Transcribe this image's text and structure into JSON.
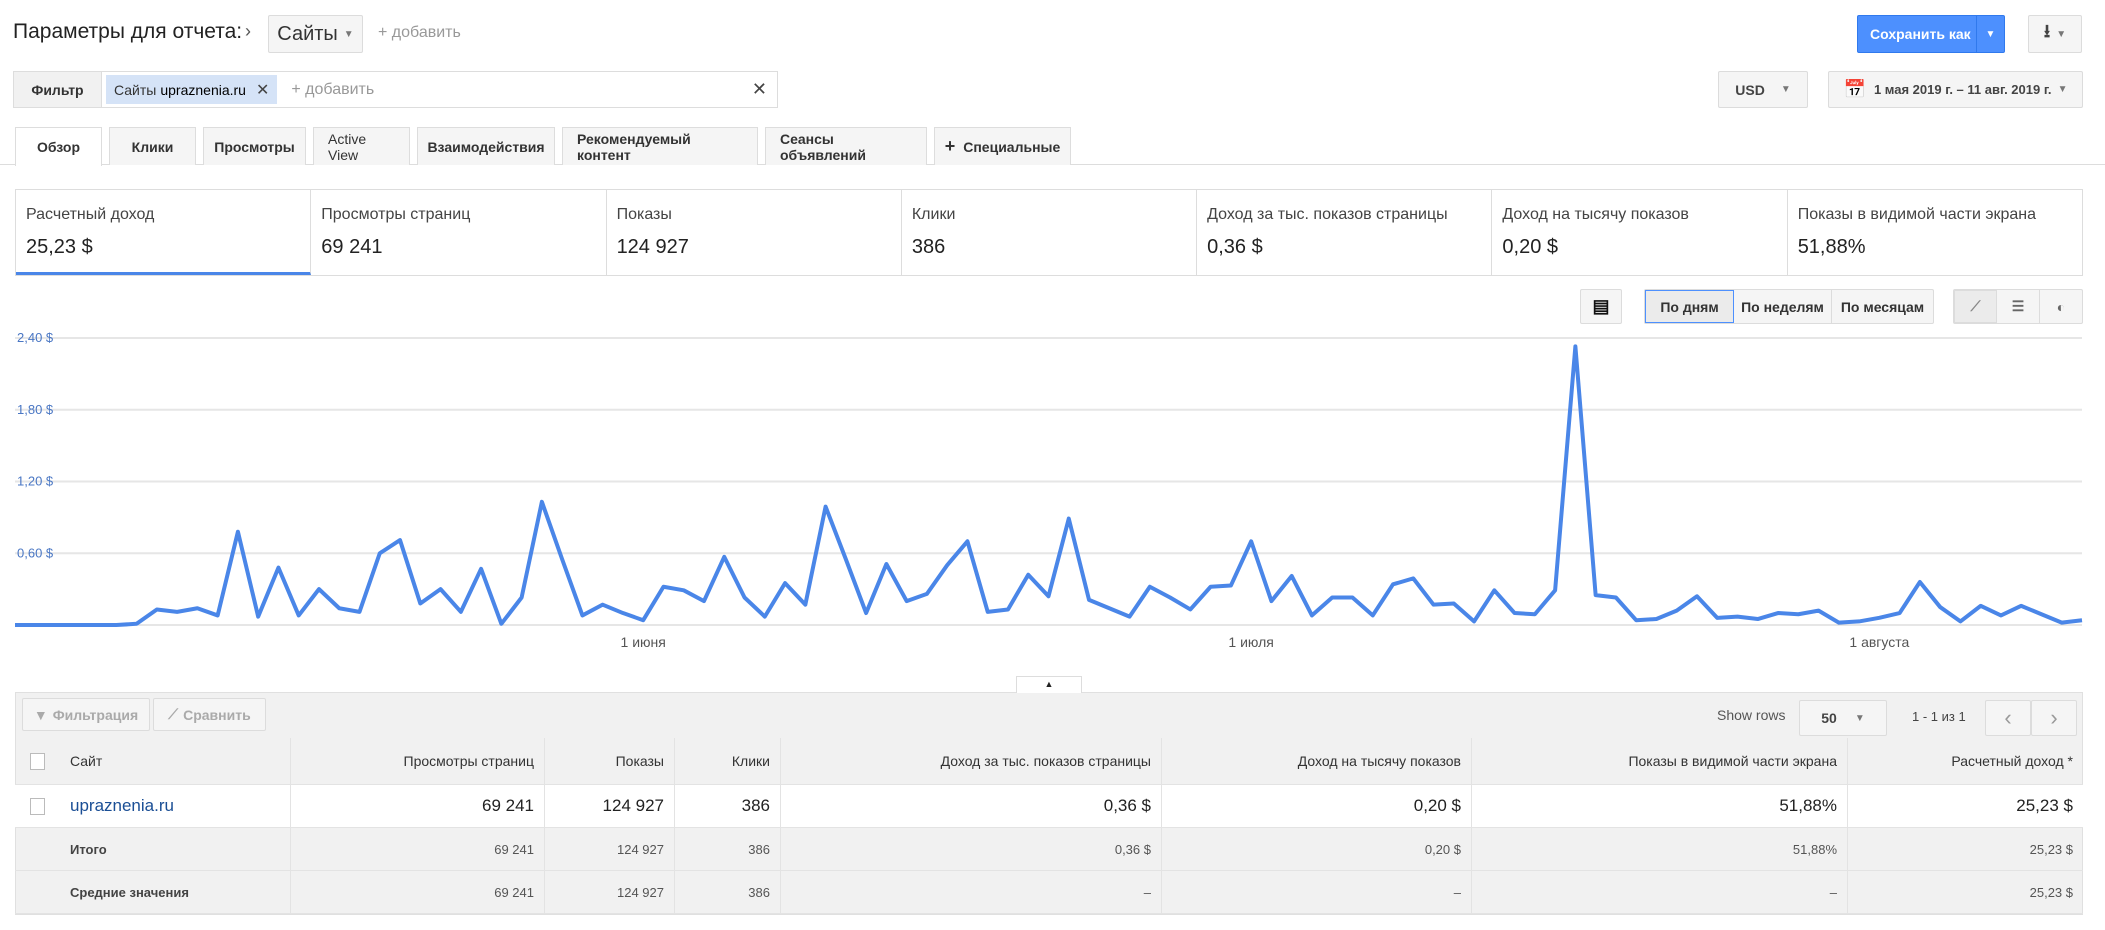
{
  "header": {
    "title": "Параметры для отчета:",
    "dimension": "Сайты",
    "add": "+ добавить",
    "save_label": "Сохранить как"
  },
  "filter": {
    "label": "Фильтр",
    "chip_prefix": "Сайты",
    "chip_value": "upraznenia.ru",
    "add": "+ добавить"
  },
  "currency": "USD",
  "date_range": "1 мая 2019 г. – 11 авг. 2019 г.",
  "tabs": [
    "Обзор",
    "Клики",
    "Просмотры",
    "Active View",
    "Взаимодействия",
    "Рекомендуемый контент",
    "Сеансы объявлений",
    "Специальные"
  ],
  "metrics": [
    {
      "label": "Расчетный доход",
      "value": "25,23 $"
    },
    {
      "label": "Просмотры страниц",
      "value": "69 241"
    },
    {
      "label": "Показы",
      "value": "124 927"
    },
    {
      "label": "Клики",
      "value": "386"
    },
    {
      "label": "Доход за тыс. показов страницы",
      "value": "0,36 $"
    },
    {
      "label": "Доход на тысячу показов",
      "value": "0,20 $"
    },
    {
      "label": "Показы в видимой части экрана",
      "value": "51,88%"
    }
  ],
  "granularity": [
    "По дням",
    "По неделям",
    "По месяцам"
  ],
  "colors": {
    "accent": "#4a86e8",
    "save": "#4d90fe"
  },
  "chart_data": {
    "type": "line",
    "title": "",
    "xlabel": "",
    "ylabel": "Расчетный доход",
    "ylim": [
      0,
      2.4
    ],
    "yticks": [
      "0,60 $",
      "1,20 $",
      "1,80 $",
      "2,40 $"
    ],
    "ytick_values": [
      0.6,
      1.2,
      1.8,
      2.4
    ],
    "xticks": [
      {
        "label": "1 июня",
        "index": 31
      },
      {
        "label": "1 июля",
        "index": 61
      },
      {
        "label": "1 августа",
        "index": 92
      }
    ],
    "x_start": "2019-05-01",
    "x_end": "2019-08-11",
    "series": [
      {
        "name": "Расчетный доход",
        "values": [
          0,
          0,
          0,
          0,
          0,
          0,
          0.01,
          0.13,
          0.11,
          0.14,
          0.08,
          0.78,
          0.07,
          0.48,
          0.08,
          0.3,
          0.14,
          0.11,
          0.6,
          0.71,
          0.18,
          0.3,
          0.11,
          0.47,
          0.01,
          0.23,
          1.03,
          0.55,
          0.08,
          0.17,
          0.1,
          0.04,
          0.32,
          0.29,
          0.2,
          0.57,
          0.23,
          0.07,
          0.35,
          0.17,
          0.99,
          0.55,
          0.1,
          0.51,
          0.2,
          0.26,
          0.5,
          0.7,
          0.11,
          0.13,
          0.42,
          0.24,
          0.89,
          0.21,
          0.14,
          0.07,
          0.32,
          0.23,
          0.13,
          0.32,
          0.33,
          0.7,
          0.2,
          0.41,
          0.08,
          0.23,
          0.23,
          0.08,
          0.34,
          0.39,
          0.17,
          0.18,
          0.03,
          0.29,
          0.1,
          0.09,
          0.29,
          2.33,
          0.25,
          0.23,
          0.04,
          0.05,
          0.12,
          0.24,
          0.06,
          0.07,
          0.05,
          0.1,
          0.09,
          0.12,
          0.02,
          0.03,
          0.06,
          0.1,
          0.36,
          0.15,
          0.03,
          0.16,
          0.08,
          0.16,
          0.09,
          0.02,
          0.04
        ]
      }
    ]
  },
  "table": {
    "filter_btn": "Фильтрация",
    "compare_btn": "Сравнить",
    "show_rows": "Show rows",
    "rows_value": "50",
    "pager": "1 - 1 из 1",
    "columns": [
      "Сайт",
      "Просмотры страниц",
      "Показы",
      "Клики",
      "Доход за тыс. показов страницы",
      "Доход на тысячу показов",
      "Показы в видимой части экрана",
      "Расчетный доход *"
    ],
    "rows": [
      [
        "upraznenia.ru",
        "69 241",
        "124 927",
        "386",
        "0,36 $",
        "0,20 $",
        "51,88%",
        "25,23 $"
      ]
    ],
    "total": [
      "Итого",
      "69 241",
      "124 927",
      "386",
      "0,36 $",
      "0,20 $",
      "51,88%",
      "25,23 $"
    ],
    "average": [
      "Средние значения",
      "69 241",
      "124 927",
      "386",
      "–",
      "–",
      "–",
      "25,23 $"
    ]
  }
}
